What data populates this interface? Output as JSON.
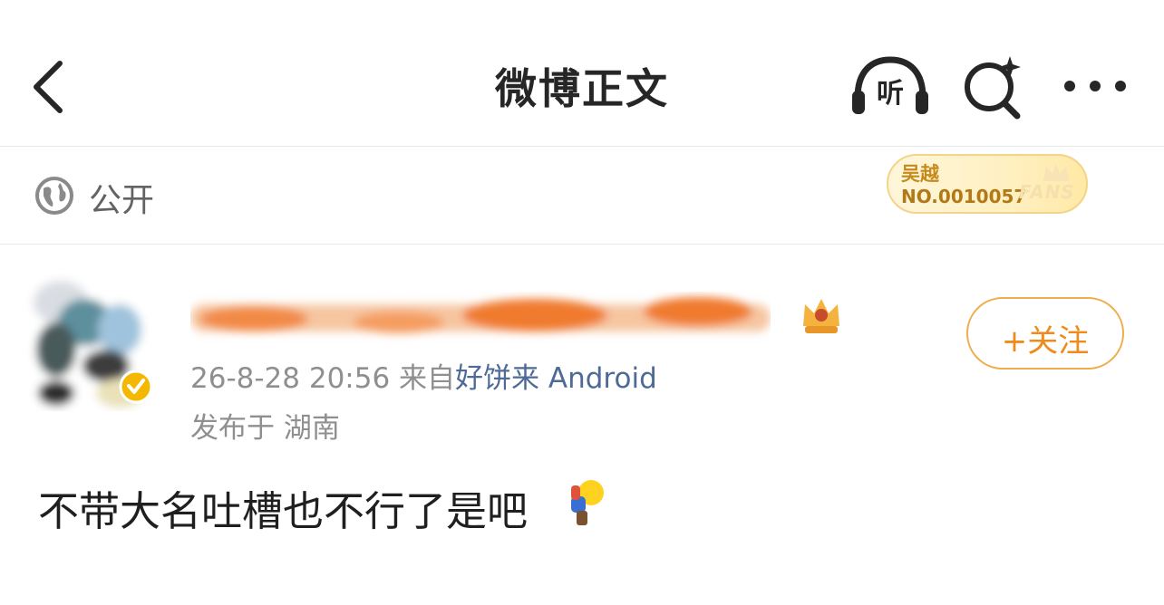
{
  "header": {
    "title": "微博正文",
    "listen_label": "听"
  },
  "visibility": {
    "label": "公开"
  },
  "fans_badge": {
    "name": "吴越",
    "number": "NO.0010057",
    "word": "FANS"
  },
  "post": {
    "timestamp": "26-8-28 20:56",
    "source_prefix": "来自",
    "source": "好饼来 Android",
    "location": "发布于 湖南",
    "follow_label": "+关注",
    "text": "不带大名吐槽也不行了是吧"
  },
  "icons": {
    "back": "chevron-left-icon",
    "listen": "headphones-icon",
    "search": "ai-search-icon",
    "more": "more-dots-icon",
    "visibility": "globe-icon",
    "verify": "verified-badge-icon",
    "level": "crown-level-icon",
    "emoji": "bowing-person-emoji-icon"
  },
  "colors": {
    "accent": "#f08a1a",
    "link": "#4e6a97",
    "muted": "#8f8f8f",
    "badge_gold": "#c58a1c"
  }
}
